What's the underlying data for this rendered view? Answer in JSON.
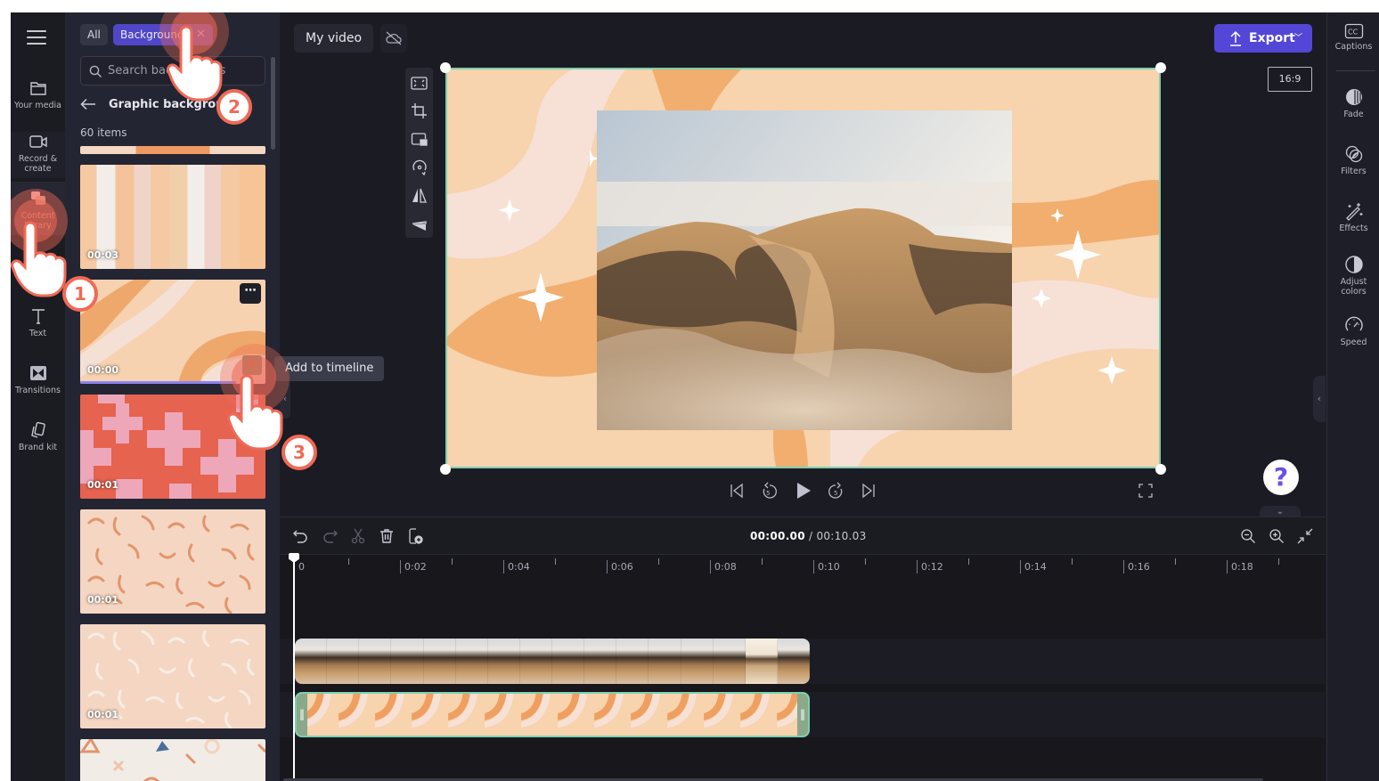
{
  "app": {
    "project_title": "My video",
    "cloud_status_icon": "cloud-off-icon",
    "export_label": "Export",
    "aspect_ratio": "16:9",
    "accent_color": "#5446d6",
    "selection_color": "#7dcfae"
  },
  "left_rail": {
    "menu_icon": "hamburger-menu-icon",
    "items": [
      {
        "label": "Your media",
        "icon": "folder-icon"
      },
      {
        "label": "Record & create",
        "icon": "video-camera-icon"
      },
      {
        "label": "Content library",
        "icon": "content-library-icon",
        "active": true
      },
      {
        "label": "Text",
        "icon": "text-icon"
      },
      {
        "label": "Transitions",
        "icon": "transitions-icon"
      },
      {
        "label": "Brand kit",
        "icon": "brand-kit-icon"
      }
    ]
  },
  "library": {
    "filters": [
      {
        "label": "All"
      },
      {
        "label": "Backgrounds",
        "selected": true,
        "removable": true
      }
    ],
    "search_placeholder": "Search backgrounds",
    "section_title": "Graphic backgrounds",
    "item_count": "60 items",
    "thumbnails": [
      {
        "name": "partial-sunburst",
        "duration": ""
      },
      {
        "name": "pastel-stripes",
        "duration": "00:03"
      },
      {
        "name": "orange-waves",
        "duration": "00:00",
        "hovered": true
      },
      {
        "name": "pink-crosses",
        "duration": "00:01"
      },
      {
        "name": "orange-squiggles",
        "duration": "00:01"
      },
      {
        "name": "cream-squiggles",
        "duration": "00:01"
      },
      {
        "name": "geometric-shapes",
        "duration": ""
      }
    ],
    "more_options_label": "⋯",
    "add_tooltip": "Add to timeline"
  },
  "preview_tools": [
    {
      "icon": "fit-screen-icon"
    },
    {
      "icon": "crop-icon"
    },
    {
      "icon": "picture-in-picture-icon"
    },
    {
      "icon": "rotate-icon"
    },
    {
      "icon": "flip-horizontal-icon"
    },
    {
      "icon": "flip-vertical-icon"
    }
  ],
  "playback": {
    "buttons": [
      {
        "icon": "skip-to-start-icon"
      },
      {
        "icon": "rewind-5-icon",
        "label": "5"
      },
      {
        "icon": "play-icon"
      },
      {
        "icon": "forward-5-icon",
        "label": "5"
      },
      {
        "icon": "skip-to-end-icon"
      }
    ],
    "fullscreen_icon": "fullscreen-icon"
  },
  "right_rail": {
    "items": [
      {
        "label": "Captions",
        "icon": "captions-icon"
      },
      {
        "label": "Fade",
        "icon": "fade-icon"
      },
      {
        "label": "Filters",
        "icon": "filters-icon"
      },
      {
        "label": "Effects",
        "icon": "effects-wand-icon"
      },
      {
        "label": "Adjust colors",
        "icon": "adjust-colors-icon"
      },
      {
        "label": "Speed",
        "icon": "speed-gauge-icon"
      }
    ]
  },
  "help": {
    "label": "?"
  },
  "timeline": {
    "toolbar": [
      {
        "icon": "undo-icon"
      },
      {
        "icon": "redo-icon"
      },
      {
        "icon": "split-scissors-icon"
      },
      {
        "icon": "delete-icon"
      },
      {
        "icon": "add-media-icon"
      }
    ],
    "current_time": "00:00.00",
    "separator": " / ",
    "total_time": "00:10.03",
    "zoom_controls": [
      {
        "icon": "zoom-out-icon"
      },
      {
        "icon": "zoom-in-icon"
      },
      {
        "icon": "fit-timeline-icon"
      }
    ],
    "ruler_labels": [
      "0",
      "0:02",
      "0:04",
      "0:06",
      "0:08",
      "0:10",
      "0:12",
      "0:14",
      "0:16",
      "0:18"
    ],
    "tracks": [
      {
        "type": "video",
        "name": "desert-dunes-clip"
      },
      {
        "type": "background",
        "name": "orange-waves-background",
        "selected": true
      }
    ]
  },
  "tutorial": {
    "steps": [
      "1",
      "2",
      "3"
    ],
    "accent": "#ef6a57"
  }
}
